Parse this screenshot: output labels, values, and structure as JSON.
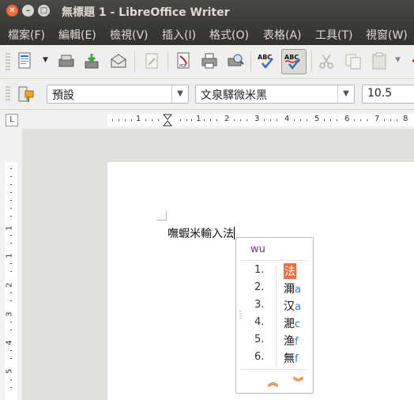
{
  "window": {
    "title": "無標題 1 - LibreOffice Writer"
  },
  "menu": [
    "檔案(F)",
    "編輯(E)",
    "檢視(V)",
    "插入(I)",
    "格式(O)",
    "表格(A)",
    "工具(T)",
    "視窗(W)"
  ],
  "toolbar": {
    "icons": [
      "new-document-icon",
      "open-icon",
      "save-icon",
      "email-icon",
      "edit-mode-icon",
      "export-pdf-icon",
      "print-icon",
      "print-preview-icon",
      "spellcheck-icon",
      "autospellcheck-icon",
      "cut-icon",
      "copy-icon",
      "paste-icon"
    ]
  },
  "format_bar": {
    "paragraph_style": "預設",
    "font_name": "文泉驛微米黑",
    "font_size": "10.5"
  },
  "ruler": {
    "tab_selector": "L",
    "h_numbers": [
      "1",
      "1",
      "2",
      "3",
      "4",
      "5",
      "6",
      "7",
      "8"
    ],
    "v_numbers": [
      "1",
      "1",
      "2",
      "3",
      "4",
      "5"
    ]
  },
  "document": {
    "text": "嘸蝦米輸入法"
  },
  "ime": {
    "preedit": "wu",
    "candidates": [
      {
        "num": "1.",
        "char": "法",
        "code": ""
      },
      {
        "num": "2.",
        "char": "濔",
        "code": "a"
      },
      {
        "num": "3.",
        "char": "汉",
        "code": "a"
      },
      {
        "num": "4.",
        "char": "淝",
        "code": "c"
      },
      {
        "num": "5.",
        "char": "渔",
        "code": "f"
      },
      {
        "num": "6.",
        "char": "無",
        "code": "f"
      }
    ],
    "prev_page": "︽",
    "next_page": "︾"
  },
  "colors": {
    "titlebar": "#3c3b37",
    "highlight": "#f0703a",
    "preedit": "#7a2d9b",
    "code": "#2a7ec8"
  }
}
